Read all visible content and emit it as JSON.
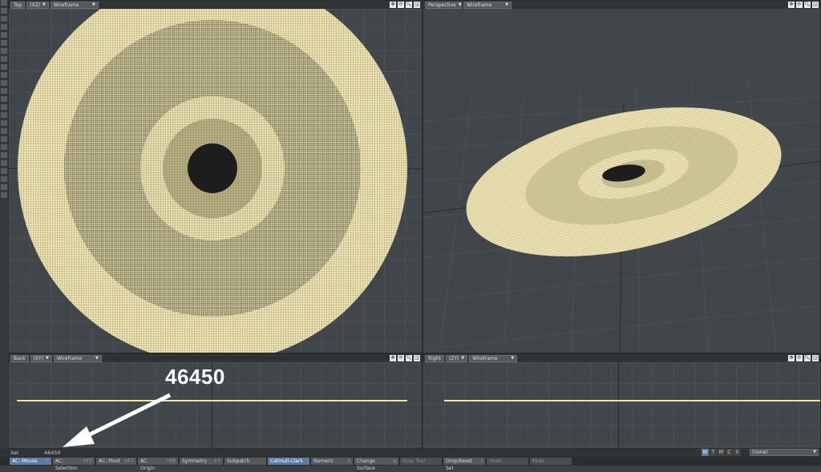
{
  "viewports": {
    "top": {
      "view": "Top",
      "axes": "(XZ)",
      "mode": "Wireframe"
    },
    "perspective": {
      "view": "Perspective",
      "mode": "Wireframe"
    },
    "back": {
      "view": "Back",
      "axes": "(XY)",
      "mode": "Wireframe"
    },
    "right": {
      "view": "Right",
      "axes": "(ZY)",
      "mode": "Wireframe"
    }
  },
  "status": {
    "sel_label": "Sel",
    "sel_value": "46450",
    "surface": "(none)"
  },
  "annotation": {
    "text": "46450"
  },
  "wtmcs": [
    "W",
    "T",
    "M",
    "C",
    "S"
  ],
  "toolbar": [
    {
      "label": "AC: Mouse",
      "key": "+",
      "state": "active"
    },
    {
      "label": "AC: Selection",
      "key": "+F7",
      "state": "normal"
    },
    {
      "label": "AC: Pivot",
      "key": "+F7",
      "state": "normal"
    },
    {
      "label": "AC: Origin",
      "key": "+F8",
      "state": "normal"
    },
    {
      "label": "Symmetry",
      "key": "+Y",
      "state": "normal"
    },
    {
      "label": "Subpatch",
      "key": "",
      "state": "normal"
    },
    {
      "label": "Catmull-Clark",
      "key": "",
      "state": "active"
    },
    {
      "label": "Numeric",
      "key": "n",
      "state": "normal"
    },
    {
      "label": "Change Surface",
      "key": "q",
      "state": "normal"
    },
    {
      "label": "Drop Tool",
      "key": "",
      "state": "dim"
    },
    {
      "label": "Drop/Reset Sel",
      "key": "/",
      "state": "normal"
    },
    {
      "label": "Undo",
      "key": "",
      "state": "dim"
    },
    {
      "label": "Redo",
      "key": "",
      "state": "dim"
    }
  ],
  "colors": {
    "mesh": "#efe5b4",
    "mesh_dark": "#2a2b26",
    "accent": "#5a7ca6"
  }
}
